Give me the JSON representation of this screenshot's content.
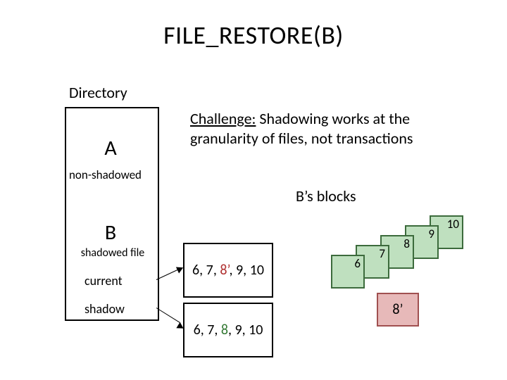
{
  "title": "FILE_RESTORE(B)",
  "directory_label": "Directory",
  "file_A": {
    "name": "A",
    "state_label": "non-shadowed"
  },
  "file_B": {
    "name": "B",
    "state_label": "shadowed file",
    "current_label": "current",
    "shadow_label": "shadow"
  },
  "challenge": {
    "lead": "Challenge:",
    "rest": " Shadowing works at the granularity of files, not transactions"
  },
  "blocks_heading": "B’s blocks",
  "current_list": {
    "a": "6, 7, ",
    "prime": "8’",
    "b": ", 9, 10"
  },
  "shadow_list": {
    "a": "6, 7, ",
    "orig": "8",
    "b": ", 9, 10"
  },
  "blocks": {
    "b6": "6",
    "b7": "7",
    "b8": "8",
    "b9": "9",
    "b10": "10"
  },
  "prime_block": "8’",
  "chart_data": {
    "type": "table",
    "title": "FILE_RESTORE(B) shadowing diagram",
    "directory_entries": [
      {
        "name": "A",
        "shadowed": false
      },
      {
        "name": "B",
        "shadowed": true,
        "current_blocks": [
          6,
          7,
          "8’",
          9,
          10
        ],
        "shadow_blocks": [
          6,
          7,
          8,
          9,
          10
        ]
      }
    ],
    "B_blocks_on_disk": [
      6,
      7,
      8,
      9,
      10
    ],
    "B_shadow_extra_block": "8’",
    "challenge": "Shadowing works at the granularity of files, not transactions"
  }
}
